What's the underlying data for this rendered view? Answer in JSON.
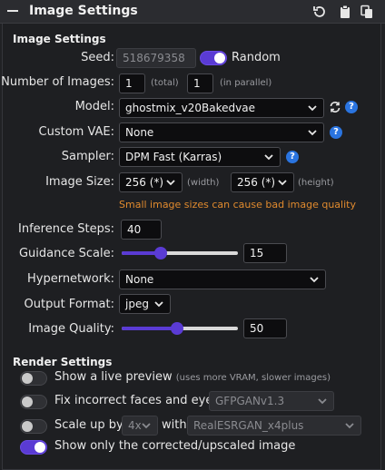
{
  "header": {
    "title": "Image Settings",
    "icons": [
      "collapse-icon",
      "reset-icon",
      "paste-icon",
      "copy-icon"
    ]
  },
  "image_settings": {
    "section_title": "Image Settings",
    "seed": {
      "label": "Seed:",
      "value": "518679358",
      "random_label": "Random",
      "random_on": true
    },
    "num_images": {
      "label": "Number of Images:",
      "total": "1",
      "total_hint": "(total)",
      "parallel": "1",
      "parallel_hint": "(in parallel)"
    },
    "model": {
      "label": "Model:",
      "value": "ghostmix_v20Bakedvae"
    },
    "vae": {
      "label": "Custom VAE:",
      "value": "None"
    },
    "sampler": {
      "label": "Sampler:",
      "value": "DPM Fast (Karras)"
    },
    "image_size": {
      "label": "Image Size:",
      "width": "256 (*)",
      "width_hint": "(width)",
      "height": "256 (*)",
      "height_hint": "(height)",
      "warning": "Small image sizes can cause bad image quality"
    },
    "inference_steps": {
      "label": "Inference Steps:",
      "value": "40"
    },
    "guidance_scale": {
      "label": "Guidance Scale:",
      "value": "15",
      "slider_fraction": 0.32
    },
    "hypernetwork": {
      "label": "Hypernetwork:",
      "value": "None"
    },
    "output_format": {
      "label": "Output Format:",
      "value": "jpeg"
    },
    "image_quality": {
      "label": "Image Quality:",
      "value": "50",
      "slider_fraction": 0.47
    }
  },
  "render_settings": {
    "section_title": "Render Settings",
    "live_preview": {
      "label": "Show a live preview",
      "note": "(uses more VRAM, slower images)",
      "on": false
    },
    "fix_faces": {
      "label": "Fix incorrect faces and eyes",
      "model": "GFPGANv1.3",
      "on": false
    },
    "upscale": {
      "label": "Scale up by",
      "factor": "4x",
      "with_label": "with",
      "model": "RealESRGAN_x4plus",
      "on": false
    },
    "show_only_corrected": {
      "label": "Show only the corrected/upscaled image",
      "on": true
    }
  },
  "colors": {
    "accent": "#5a3bd4",
    "warning": "#e08a2e",
    "help": "#2a74e0",
    "background": "#1e1f22"
  }
}
